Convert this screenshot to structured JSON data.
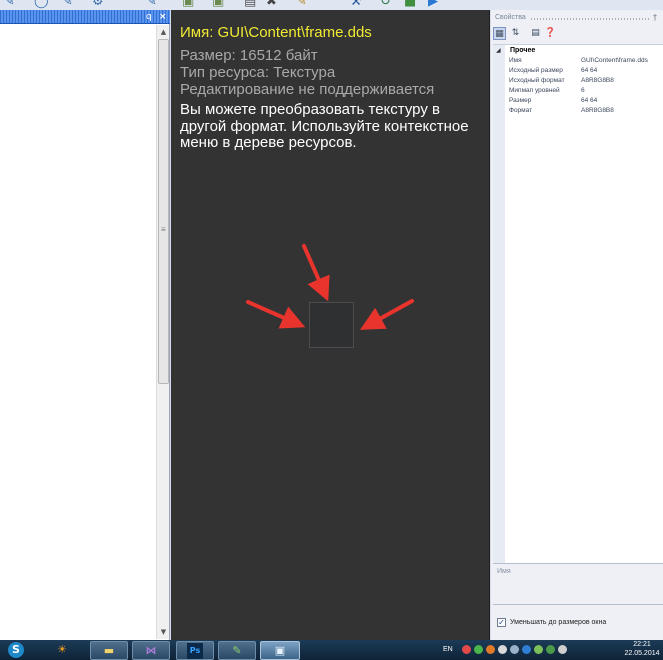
{
  "toolbar": {
    "icons": [
      "pencil-icon",
      "circle-icon",
      "pencil-icon",
      "gear-icon",
      "pencil-icon",
      "image-icon",
      "image-icon",
      "save-icon",
      "close-icon",
      "tools-icon",
      "refresh-icon",
      "box-icon",
      "play-icon"
    ]
  },
  "left_panel": {
    "pin_glyph": "q",
    "close_glyph": "×",
    "scroll_up": "▲",
    "scroll_down": "▼",
    "grip": "≡"
  },
  "preview": {
    "name_line": "Имя: GUI\\Content\\frame.dds",
    "size_line": "Размер: 16512 байт",
    "type_line": "Тип ресурса: Текстура",
    "edit_line": "Редактирование не поддерживается",
    "hint": "Вы можете преобразовать текстуру в другой формат. Используйте контекстное меню в дереве ресурсов.",
    "texture_color": "#2e3032",
    "arrow_color": "#e8342c"
  },
  "properties": {
    "title": "Свойства",
    "pin_glyph": "†",
    "category": "Прочее",
    "rows": [
      {
        "key": "Имя",
        "value": "GUI\\Content\\frame.dds"
      },
      {
        "key": "Исходный размер",
        "value": "64 64"
      },
      {
        "key": "Исходный формат",
        "value": "A8R8G8B8"
      },
      {
        "key": "Мипмап уровней",
        "value": "6"
      },
      {
        "key": "Размер",
        "value": "64 64"
      },
      {
        "key": "Формат",
        "value": "A8R8G8B8"
      }
    ],
    "description_label": "Имя",
    "fit_checkbox_label": "Уменьшать до размеров окна",
    "fit_checked": true
  },
  "taskbar": {
    "language": "EN",
    "time": "22:21",
    "date": "22.05.2014"
  }
}
